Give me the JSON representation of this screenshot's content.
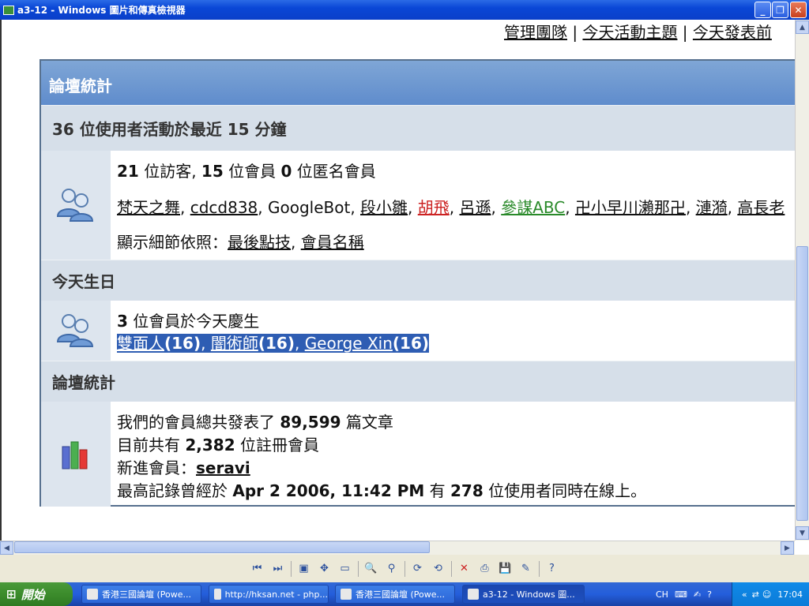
{
  "window": {
    "title": "a3-12 - Windows 圖片和傳真檢視器"
  },
  "forum": {
    "top_links": [
      "管理團隊",
      "今天活動主題",
      "今天發表前"
    ],
    "stats_header": "論壇統計",
    "online": {
      "title": "36 位使用者活動於最近 15 分鐘",
      "summary_guests_num": "21",
      "summary_guests_text": " 位訪客, ",
      "summary_members_num": "15",
      "summary_members_text": " 位會員 ",
      "summary_hidden_num": "0",
      "summary_hidden_text": " 位匿名會員",
      "users": [
        "梵天之舞",
        "cdcd838",
        "GoogleBot",
        "段小雛",
        "胡飛",
        "呂遜",
        "參謀ABC",
        "卍小早川瀨那卍",
        "漣漪",
        "高長老"
      ],
      "sort_label": "顯示細節依照：",
      "sort_options": [
        "最後點技",
        "會員名稱"
      ]
    },
    "birthday": {
      "title": "今天生日",
      "count_num": "3",
      "count_text": " 位會員於今天慶生",
      "members": [
        {
          "name": "雙面人",
          "age": "(16)"
        },
        {
          "name": "闇術師",
          "age": "(16)"
        },
        {
          "name": "George Xin",
          "age": "(16)"
        }
      ]
    },
    "board_stats": {
      "title": "論壇統計",
      "line1_pre": "我們的會員總共發表了 ",
      "line1_num": "89,599",
      "line1_post": " 篇文章",
      "line2_pre": "目前共有 ",
      "line2_num": "2,382",
      "line2_post": " 位註冊會員",
      "line3_pre": "新進會員：",
      "line3_user": "seravi",
      "line4_pre": "最高記錄曾經於 ",
      "line4_date": "Apr 2 2006, 11:42 PM",
      "line4_mid": " 有 ",
      "line4_num": "278",
      "line4_post": " 位使用者同時在線上。"
    }
  },
  "taskbar": {
    "start_label": "開始",
    "tasks": [
      "香港三國論壇 (Powe...",
      "http://hksan.net - php...",
      "香港三國論壇 (Powe...",
      "a3-12 - Windows 圖..."
    ],
    "lang": "CH",
    "clock": "17:04"
  },
  "icons": {
    "users": "users-group-icon",
    "birthday": "users-group-icon",
    "stats": "bar-chart-icon"
  }
}
